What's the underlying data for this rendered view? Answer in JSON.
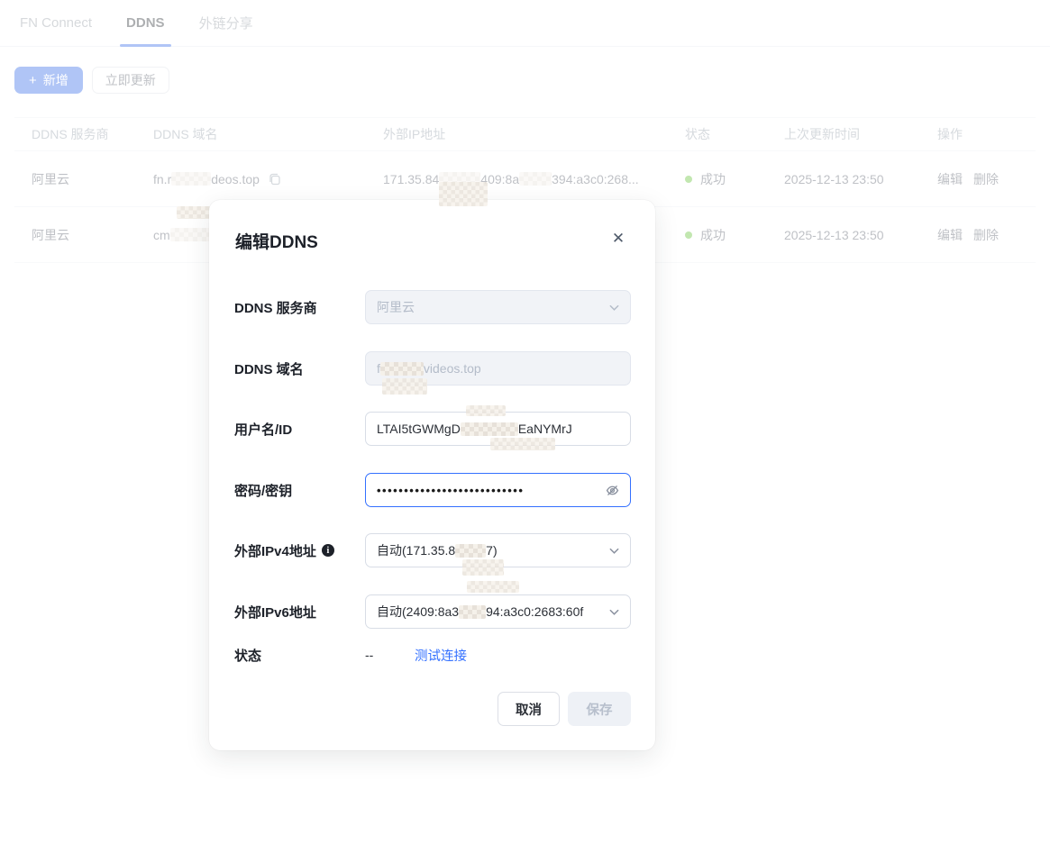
{
  "tabs": {
    "items": [
      {
        "label": "FN Connect"
      },
      {
        "label": "DDNS"
      },
      {
        "label": "外链分享"
      }
    ]
  },
  "toolbar": {
    "plus": "+",
    "add": "新增",
    "update": "立即更新"
  },
  "table": {
    "headers": {
      "provider": "DDNS 服务商",
      "domain": "DDNS 域名",
      "ip": "外部IP地址",
      "status": "状态",
      "updated": "上次更新时间",
      "actions": "操作"
    },
    "rows": [
      {
        "provider": "阿里云",
        "domain_a": "fn.r",
        "domain_b": "deos.top",
        "ip_a": "171.35.84",
        "ip_b": "409:8a",
        "ip_c": "394:a3c0:268...",
        "status": "成功",
        "updated": "2025-12-13 23:50",
        "edit": "编辑",
        "delete": "删除"
      },
      {
        "provider": "阿里云",
        "domain_a": "cm",
        "domain_b": "",
        "status": "成功",
        "updated": "2025-12-13 23:50",
        "edit": "编辑",
        "delete": "删除"
      }
    ]
  },
  "modal": {
    "title": "编辑DDNS",
    "close": "✕",
    "provider": {
      "label": "DDNS 服务商",
      "value": "阿里云"
    },
    "domain": {
      "label": "DDNS 域名",
      "value_a": "f",
      "value_b": "videos.top"
    },
    "username": {
      "label": "用户名/ID",
      "value_a": "LTAI5tGWMgD",
      "value_b": "EaNYMrJ"
    },
    "password": {
      "label": "密码/密钥",
      "masked": "•••••••••••••••••••••••••••"
    },
    "ipv4": {
      "label": "外部IPv4地址",
      "info": "i",
      "value_a": "自动(171.35.8",
      "value_b": "7)"
    },
    "ipv6": {
      "label": "外部IPv6地址",
      "value_a": "自动(2409:8a3",
      "value_b": "94:a3c0:2683:60f"
    },
    "status": {
      "label": "状态",
      "value": "--",
      "test_link": "测试连接"
    },
    "buttons": {
      "cancel": "取消",
      "save": "保存"
    }
  },
  "colors": {
    "accent": "#3a6ee8",
    "success": "#67c23a",
    "link": "#3370ff"
  }
}
